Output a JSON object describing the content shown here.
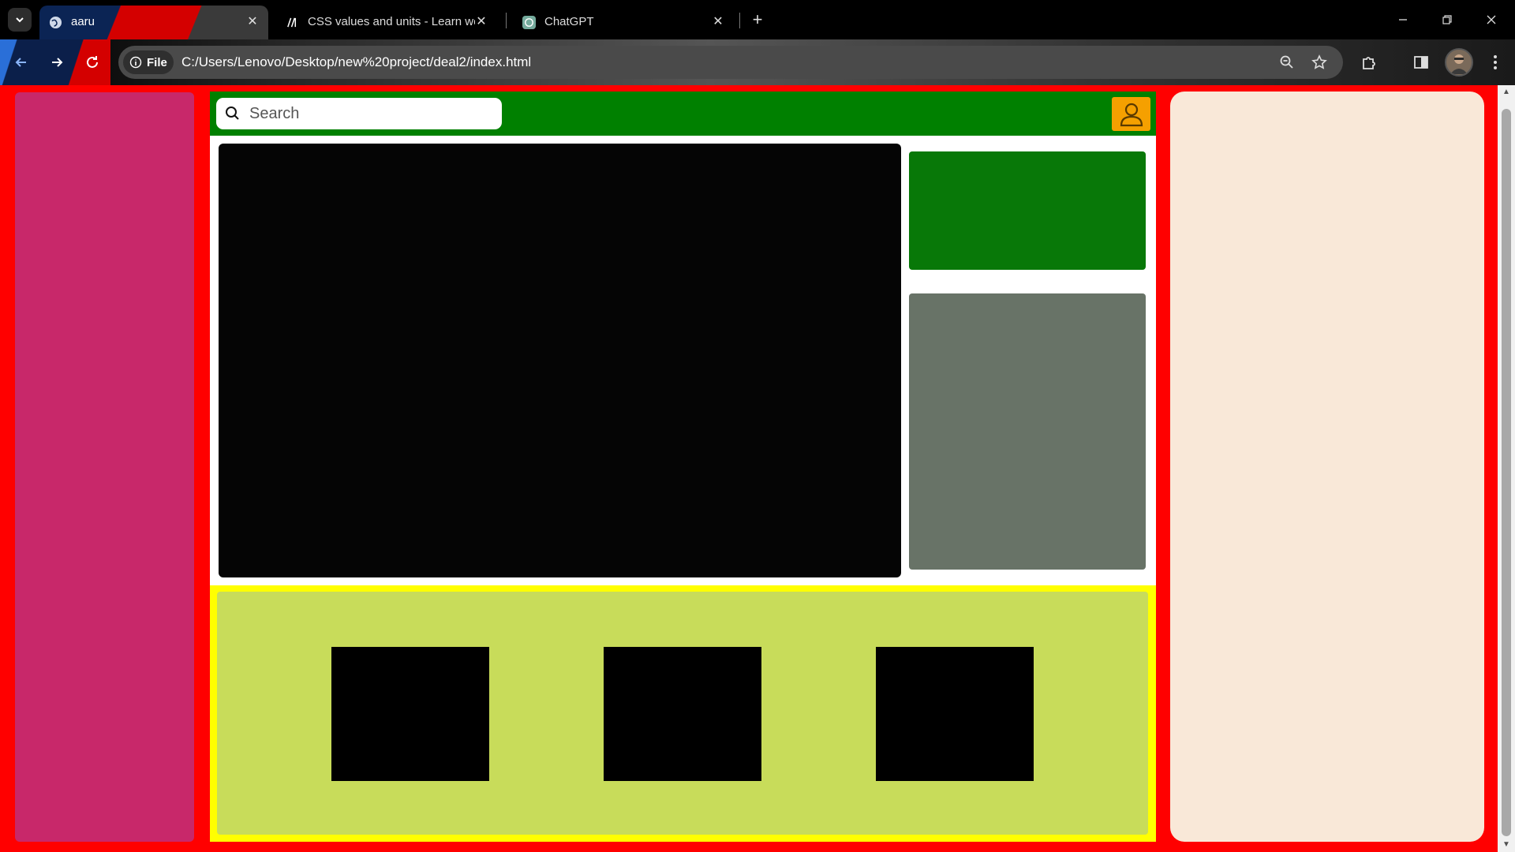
{
  "browser": {
    "tabs": [
      {
        "title": "aaru",
        "favicon": "globe-icon",
        "active": true
      },
      {
        "title": "CSS values and units - Learn we",
        "favicon": "mdn-icon",
        "active": false
      },
      {
        "title": "ChatGPT",
        "favicon": "chatgpt-icon",
        "active": false
      }
    ],
    "address_chip": "File",
    "url": "C:/Users/Lenovo/Desktop/new%20project/deal2/index.html",
    "close_glyph": "✕",
    "new_tab_glyph": "+"
  },
  "page": {
    "search": {
      "placeholder": "Search"
    },
    "colors": {
      "background": "#ff0000",
      "left_panel": "#c8286a",
      "topbar": "#008000",
      "user_button": "#f5a000",
      "video": "#050505",
      "card_green": "#087808",
      "card_gray": "#687367",
      "bottom_border": "#ffff00",
      "bottom_fill": "#c8dc5a",
      "right_panel": "#f9e8d8"
    }
  }
}
